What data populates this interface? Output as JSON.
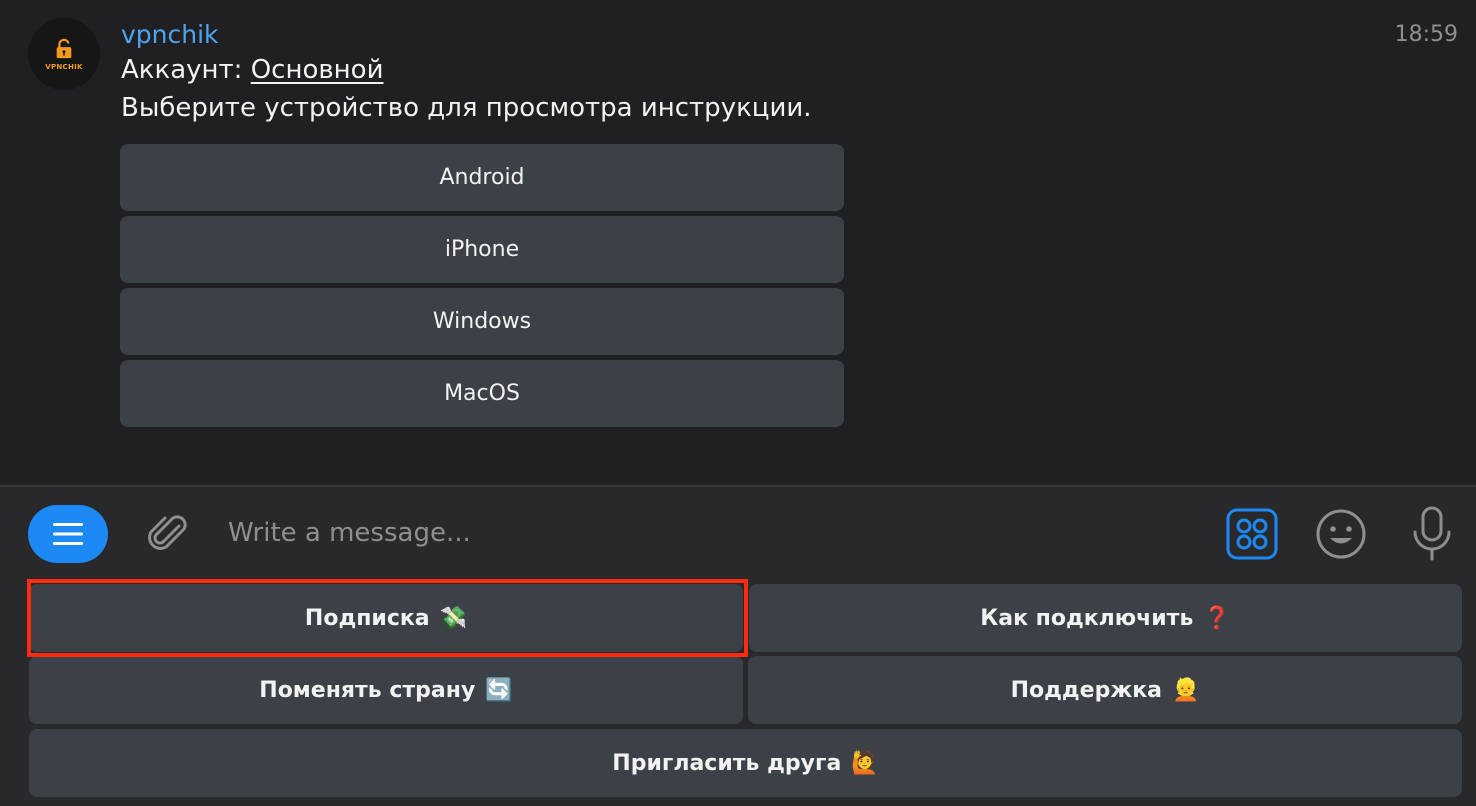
{
  "message": {
    "sender": "vpnchik",
    "time": "18:59",
    "account_label": "Аккаунт:",
    "account_link": "Основной",
    "text": "Выберите устройство для просмотра инструкции.",
    "avatar_text": "VPNCHIK",
    "inline_buttons": [
      {
        "label": "Android"
      },
      {
        "label": "iPhone"
      },
      {
        "label": "Windows"
      },
      {
        "label": "MacOS"
      }
    ]
  },
  "composer": {
    "placeholder": "Write a message..."
  },
  "reply_keyboard": [
    {
      "label": "Подписка",
      "emoji": "💸"
    },
    {
      "label": "Как подключить",
      "emoji": "❓"
    },
    {
      "label": "Поменять страну",
      "emoji": "🔄"
    },
    {
      "label": "Поддержка",
      "emoji": "👱"
    },
    {
      "label": "Пригласить друга",
      "emoji": "🙋"
    }
  ],
  "colors": {
    "accent": "#1c89f5",
    "sender": "#4ea4f2",
    "highlight": "#ff2a12",
    "button_bg": "#3c4047"
  }
}
